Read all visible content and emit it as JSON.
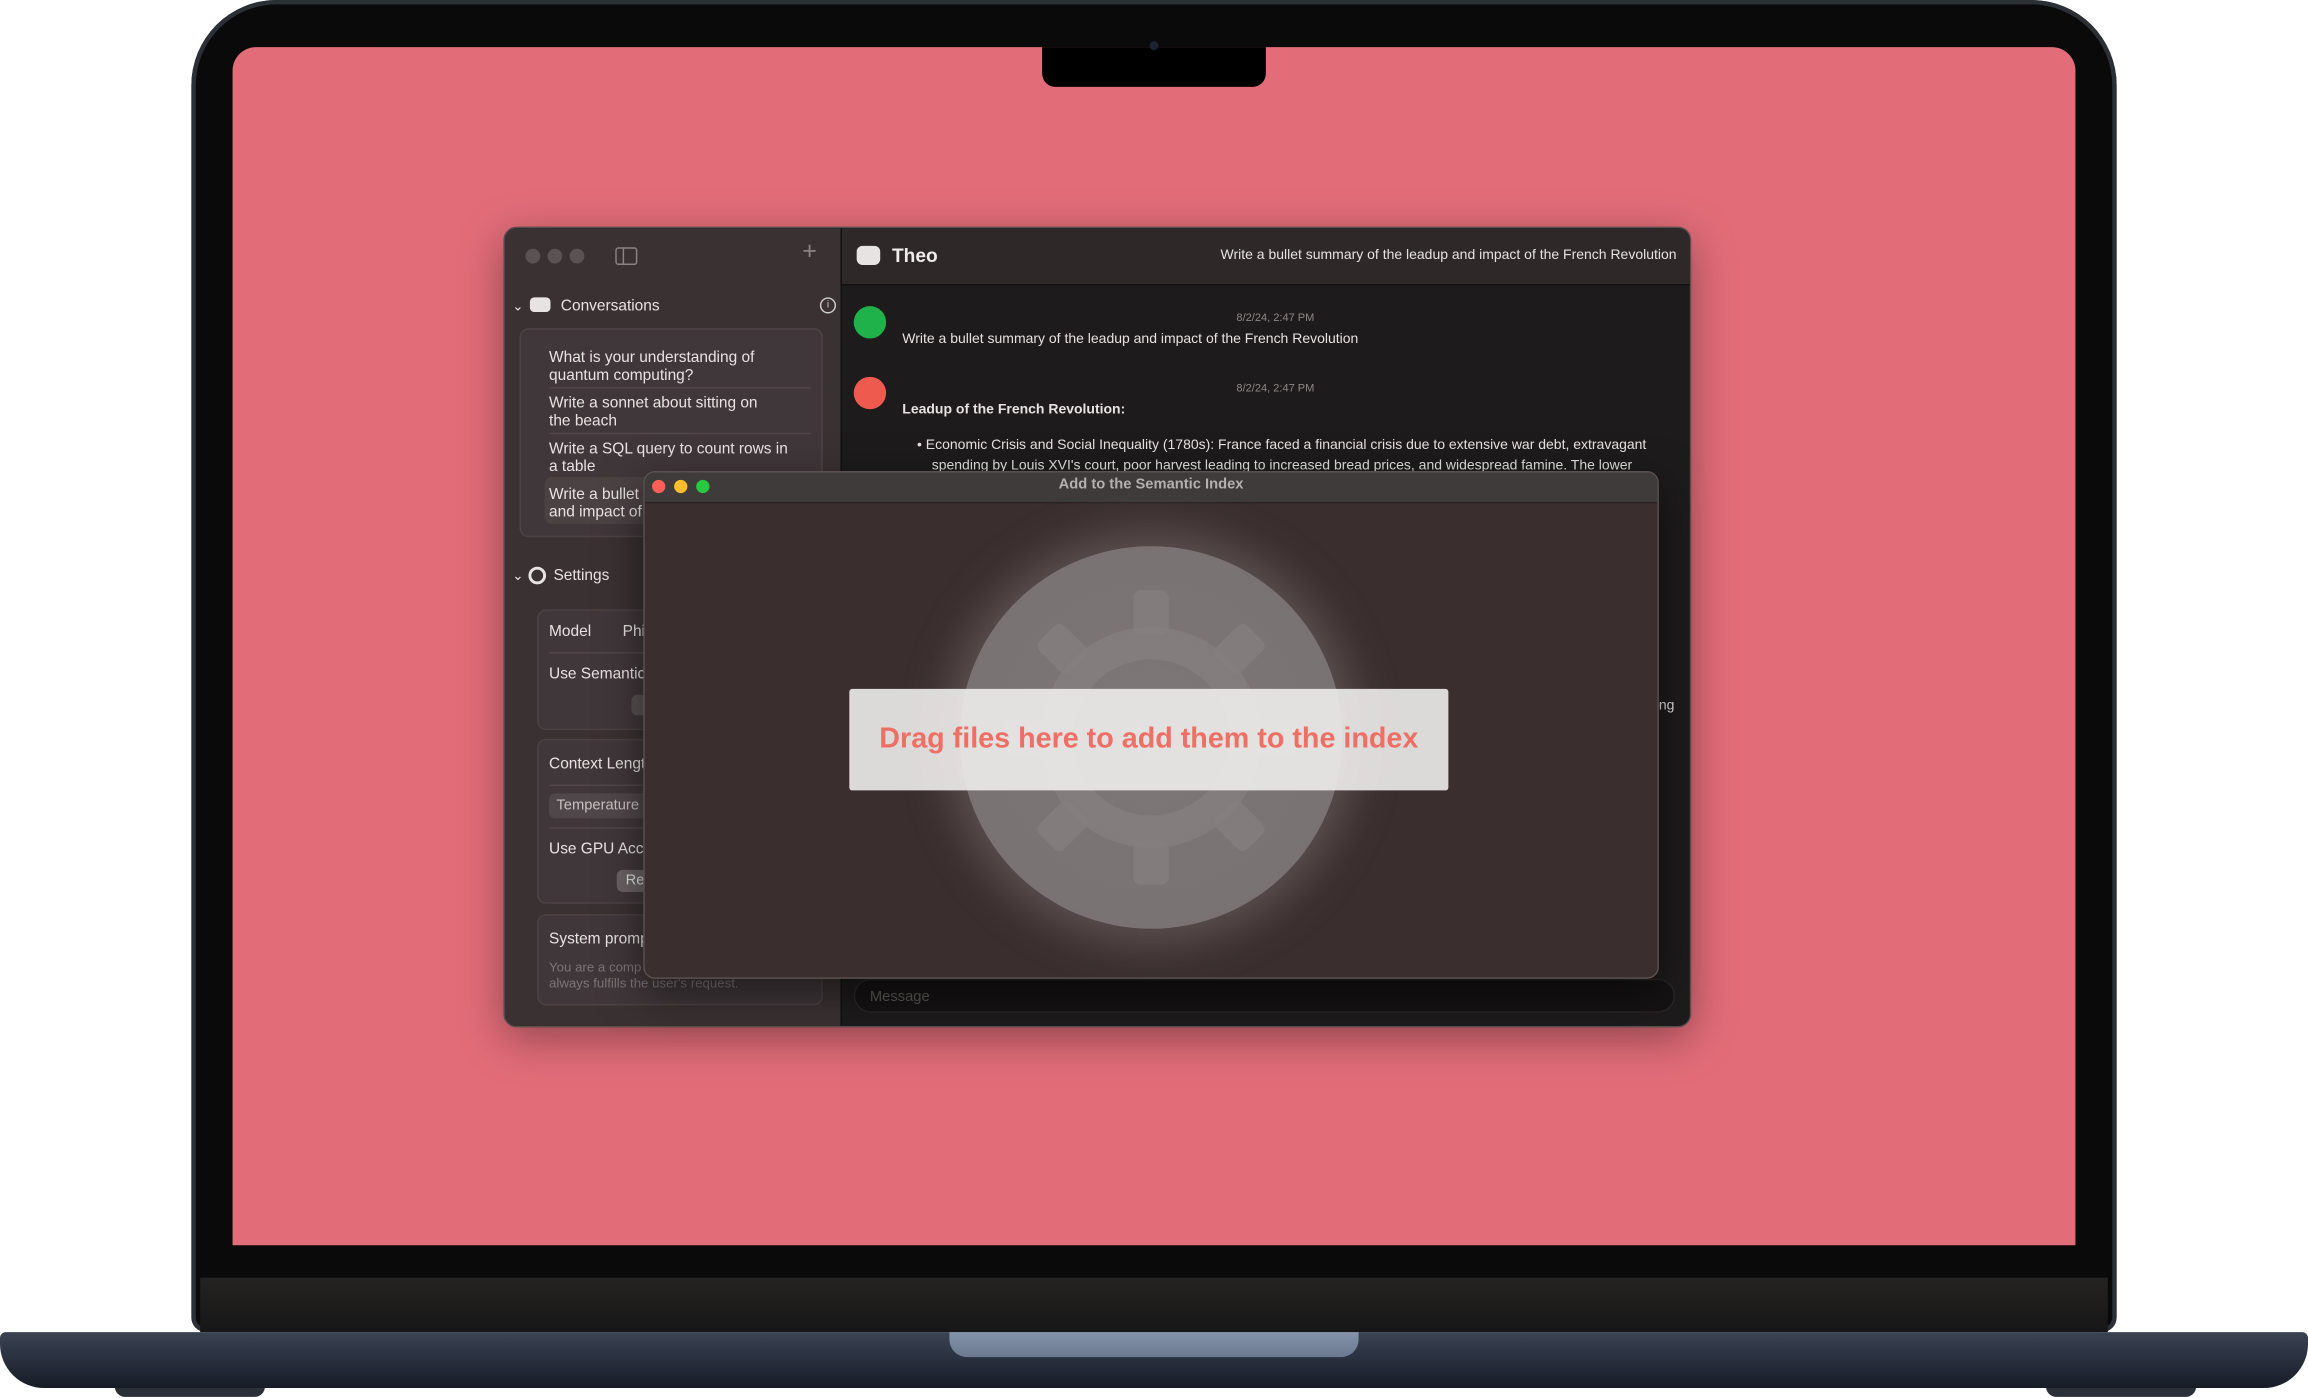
{
  "colors": {
    "wallpaper": "#e26d79",
    "accent": "#ee6f64",
    "user_avatar": "#1fb14a",
    "bot_avatar": "#ef5a4f"
  },
  "sidebar": {
    "new_button": "+",
    "conversations": {
      "title": "Conversations",
      "items": [
        {
          "line1": "What is your understanding of",
          "line2": "quantum computing?"
        },
        {
          "line1": "Write a sonnet about sitting on",
          "line2": "the beach"
        },
        {
          "line1": "Write a SQL query to count rows in",
          "line2": "a table"
        },
        {
          "line1": "Write a bullet",
          "line2": "and impact of",
          "selected": true
        }
      ]
    },
    "settings": {
      "title": "Settings",
      "model_label": "Model",
      "model_value": "Phi",
      "semantic_label": "Use Semantic",
      "context_label": "Context Lengt",
      "temperature_label": "Temperature",
      "gpu_label": "Use GPU Acce",
      "reset_label": "Re",
      "system_prompt_label": "System promp",
      "system_prompt_line1": "You are a comp",
      "system_prompt_line2": "always fulfills the user's request."
    }
  },
  "chat": {
    "assistant_name": "Theo",
    "title": "Write a bullet summary of the leadup and impact of the French Revolution",
    "messages": [
      {
        "role": "user",
        "time": "8/2/24, 2:47 PM",
        "text": "Write a bullet summary of the leadup and impact of the French Revolution"
      },
      {
        "role": "assistant",
        "time": "8/2/24, 2:47 PM",
        "heading": "Leadup of the French Revolution:",
        "bullet_line1": "Economic Crisis and Social Inequality (1780s): France faced a financial crisis due to extensive war debt, extravagant",
        "bullet_line2": "spending by Louis XVI's court, poor harvest leading to increased bread prices, and widespread famine. The lower",
        "fragment": "ng"
      }
    ],
    "message_placeholder": "Message"
  },
  "modal": {
    "title": "Add to the Semantic Index",
    "drop_text": "Drag files here to add them to the index"
  }
}
